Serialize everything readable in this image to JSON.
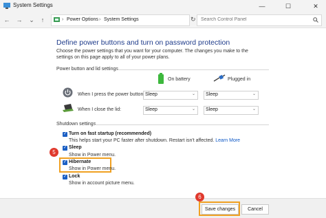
{
  "window": {
    "title": "System Settings",
    "minimize_icon": "—",
    "maximize_icon": "☐",
    "close_icon": "✕"
  },
  "nav": {
    "back_icon": "←",
    "forward_icon": "→",
    "dropdown_icon": "⌄",
    "up_icon": "↑",
    "breadcrumb": [
      "Power Options",
      "System Settings"
    ],
    "separator": "›",
    "refresh_icon": "↻",
    "search_placeholder": "Search Control Panel"
  },
  "heading": "Define power buttons and turn on password protection",
  "description": "Choose the power settings that you want for your computer. The changes you make to the settings on this page apply to all of your power plans.",
  "power_section": {
    "label": "Power button and lid settings",
    "on_battery": "On battery",
    "plugged_in": "Plugged in",
    "rows": [
      {
        "label": "When I press the power button:",
        "battery": "Sleep",
        "plugged": "Sleep"
      },
      {
        "label": "When I close the lid:",
        "battery": "Sleep",
        "plugged": "Sleep"
      }
    ]
  },
  "shutdown_section": {
    "label": "Shutdown settings",
    "options": [
      {
        "label": "Turn on fast startup (recommended)",
        "hint": "This helps start your PC faster after shutdown. Restart isn't affected.",
        "link": "Learn More",
        "checked": true
      },
      {
        "label": "Sleep",
        "hint": "Show in Power menu.",
        "checked": true
      },
      {
        "label": "Hibernate",
        "hint": "Show in Power menu.",
        "checked": true
      },
      {
        "label": "Lock",
        "hint": "Show in account picture menu.",
        "checked": true
      }
    ]
  },
  "annotations": {
    "step5": "5",
    "step6": "6",
    "highlight_color": "#f0a021",
    "badge_color": "#e0392d"
  },
  "footer": {
    "save_label": "Save changes",
    "cancel_label": "Cancel"
  },
  "colors": {
    "heading": "#1e3b8a",
    "checkbox": "#1b5fc4",
    "link": "#0b56c5"
  }
}
